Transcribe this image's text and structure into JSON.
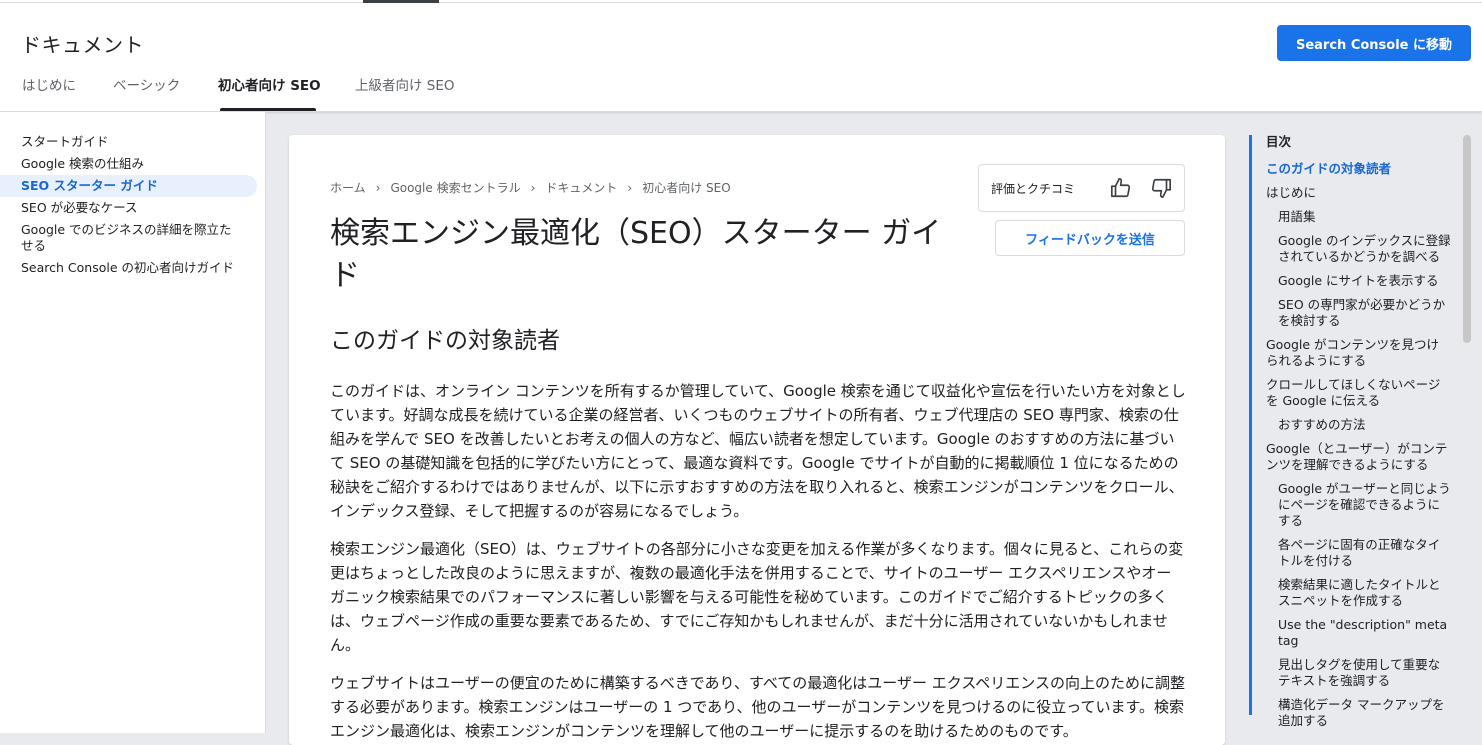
{
  "header": {
    "site_title": "ドキュメント",
    "cta_label": "Search Console に移動",
    "tabs": [
      {
        "label": "はじめに"
      },
      {
        "label": "ベーシック"
      },
      {
        "label": "初心者向け SEO"
      },
      {
        "label": "上級者向け SEO"
      }
    ]
  },
  "leftnav": {
    "items": [
      {
        "label": "スタートガイド"
      },
      {
        "label": "Google 検索の仕組み"
      },
      {
        "label": "SEO スターター ガイド"
      },
      {
        "label": "SEO が必要なケース"
      },
      {
        "label": "Google でのビジネスの詳細を際立たせる"
      },
      {
        "label": "Search Console の初心者向けガイド"
      }
    ]
  },
  "breadcrumb": [
    "ホーム",
    "Google 検索セントラル",
    "ドキュメント",
    "初心者向け SEO"
  ],
  "rating": {
    "label": "評価とクチコミ",
    "feedback_label": "フィードバックを送信"
  },
  "main": {
    "title": "検索エンジン最適化（SEO）スターター ガイド",
    "section_title": "このガイドの対象読者",
    "paragraphs": [
      "このガイドは、オンライン コンテンツを所有するか管理していて、Google 検索を通じて収益化や宣伝を行いたい方を対象としています。好調な成長を続けている企業の経営者、いくつものウェブサイトの所有者、ウェブ代理店の SEO 専門家、検索の仕組みを学んで SEO を改善したいとお考えの個人の方など、幅広い読者を想定しています。Google のおすすめの方法に基づいて SEO の基礎知識を包括的に学びたい方にとって、最適な資料です。Google でサイトが自動的に掲載順位 1 位になるための秘訣をご紹介するわけではありませんが、以下に示すおすすめの方法を取り入れると、検索エンジンがコンテンツをクロール、インデックス登録、そして把握するのが容易になるでしょう。",
      "検索エンジン最適化（SEO）は、ウェブサイトの各部分に小さな変更を加える作業が多くなります。個々に見ると、これらの変更はちょっとした改良のように思えますが、複数の最適化手法を併用することで、サイトのユーザー エクスペリエンスやオーガニック検索結果でのパフォーマンスに著しい影響を与える可能性を秘めています。このガイドでご紹介するトピックの多くは、ウェブページ作成の重要な要素であるため、すでにご存知かもしれませんが、まだ十分に活用されていないかもしれません。",
      "ウェブサイトはユーザーの便宜のために構築するべきであり、すべての最適化はユーザー エクスペリエンスの向上のために調整する必要があります。検索エンジンはユーザーの 1 つであり、他のユーザーがコンテンツを見つけるのに役立っています。検索エンジン最適化は、検索エンジンがコンテンツを理解して他のユーザーに提示するのを助けるためのものです。"
    ]
  },
  "toc": {
    "heading": "目次",
    "items": [
      {
        "label": "このガイドの対象読者"
      },
      {
        "label": "はじめに"
      },
      {
        "label": "用語集"
      },
      {
        "label": "Google のインデックスに登録されているかどうかを調べる"
      },
      {
        "label": "Google にサイトを表示する"
      },
      {
        "label": "SEO の専門家が必要かどうかを検討する"
      },
      {
        "label": "Google がコンテンツを見つけられるようにする"
      },
      {
        "label": "クロールしてほしくないページを Google に伝える"
      },
      {
        "label": "おすすめの方法"
      },
      {
        "label": "Google（とユーザー）がコンテンツを理解できるようにする"
      },
      {
        "label": "Google がユーザーと同じようにページを確認できるようにする"
      },
      {
        "label": "各ページに固有の正確なタイトルを付ける"
      },
      {
        "label": "検索結果に適したタイトルとスニペットを作成する"
      },
      {
        "label": "Use the \"description\" meta tag"
      },
      {
        "label": "見出しタグを使用して重要なテキストを強調する"
      },
      {
        "label": "構造化データ マークアップを追加する"
      }
    ]
  },
  "colors": {
    "accent": "#1a73e8",
    "active_nav_bg": "#e8f0fe",
    "page_bg": "#e8eaed"
  }
}
